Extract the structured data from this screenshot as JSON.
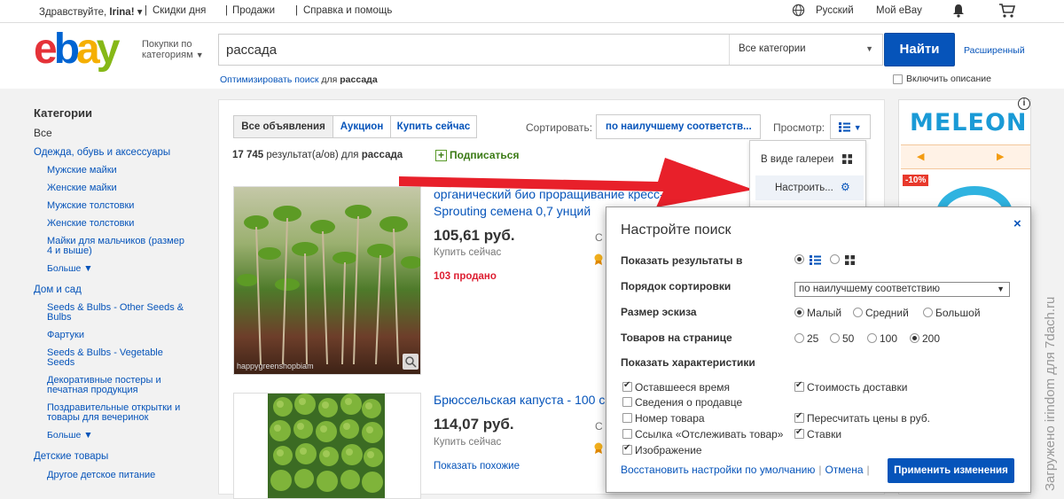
{
  "topbar": {
    "greeting_prefix": "Здравствуйте, ",
    "greeting_name": "Irina!",
    "greeting_caret": "▾",
    "link_deals": "Скидки дня",
    "link_sell": "Продажи",
    "link_help": "Справка и помощь",
    "language": "Русский",
    "my_ebay": "Мой eBay"
  },
  "header": {
    "logo_e": "e",
    "logo_b": "b",
    "logo_a": "a",
    "logo_y": "y",
    "shop_by_line1": "Покупки по",
    "shop_by_line2": "категориям",
    "search_value": "рассада",
    "category": "Все категории",
    "find_button": "Найти",
    "advanced": "Расширенный",
    "optimize_link": "Оптимизировать поиск",
    "optimize_for": " для ",
    "optimize_query": "рассада",
    "include_desc": "Включить описание"
  },
  "sidebar": {
    "heading": "Категории",
    "all": "Все",
    "cat1": "Одежда, обувь и аксессуары",
    "cat1_items": [
      "Мужские майки",
      "Женские майки",
      "Мужские толстовки",
      "Женские толстовки",
      "Майки для мальчиков (размер 4 и выше)"
    ],
    "more": "Больше",
    "cat2": "Дом и сад",
    "cat2_items": [
      "Seeds & Bulbs - Other Seeds & Bulbs",
      "Фартуки",
      "Seeds & Bulbs - Vegetable Seeds",
      "Декоративные постеры и печатная продукция",
      "Поздравительные открытки и товары для вечеринок"
    ],
    "cat3": "Детские товары",
    "cat3_items": [
      "Другое детское питание"
    ]
  },
  "results": {
    "tab_all": "Все объявления",
    "tab_auction": "Аукцион",
    "tab_buynow": "Купить сейчас",
    "sort_label": "Сортировать:",
    "sort_value": "по наилучшему соответств...",
    "view_label": "Просмотр:",
    "count": "17 745",
    "count_suffix": " результат(а/ов) для ",
    "count_query": "рассада",
    "subscribe": "Подписаться",
    "items": [
      {
        "title": "органический био проращивание кресс-салат Sprouting семена 0,7 унций",
        "price": "105,61 руб.",
        "buy": "Купить сейчас",
        "sold": "103 продано",
        "image_caption": "happygreenshopbiam"
      },
      {
        "title": "Брюссельская капуста - 100 семян",
        "price": "114,07 руб.",
        "buy": "Купить сейчас",
        "similar": "Показать похожие"
      }
    ]
  },
  "view_menu": {
    "gallery": "В виде галереи",
    "customize": "Настроить..."
  },
  "ad": {
    "brand": "MELEON",
    "badge": "-10%",
    "prev": "◀",
    "next": "▶"
  },
  "dialog": {
    "title": "Настройте поиск",
    "close": "×",
    "show_results_label": "Показать результаты в",
    "sort_label": "Порядок сортировки",
    "sort_value": "по наилучшему соответствию",
    "thumb_label": "Размер эскиза",
    "thumb_small": "Малый",
    "thumb_medium": "Средний",
    "thumb_large": "Большой",
    "per_page_label": "Товаров на странице",
    "per_page": [
      "25",
      "50",
      "100",
      "200"
    ],
    "features_label": "Показать характеристики",
    "features_left": [
      {
        "label": "Оставшееся время",
        "checked": true
      },
      {
        "label": "Сведения о продавце",
        "checked": false
      },
      {
        "label": "Номер товара",
        "checked": false
      },
      {
        "label": "Ссылка «Отслеживать товар»",
        "checked": false
      },
      {
        "label": "Изображение",
        "checked": true
      }
    ],
    "features_right": [
      {
        "label": "Стоимость доставки",
        "checked": true
      },
      {
        "label": "Пересчитать цены в руб.",
        "checked": true
      },
      {
        "label": "Ставки",
        "checked": true
      }
    ],
    "restore": "Восстановить настройки по умолчанию",
    "cancel": "Отмена",
    "apply": "Применить изменения"
  },
  "watermark": "Загружено irindom для 7dach.ru",
  "colors": {
    "link": "#0654ba",
    "button": "#0654ba",
    "sold": "#dd1e31",
    "arrow": "#e8202a",
    "ad_brand": "#1a9ad6"
  }
}
